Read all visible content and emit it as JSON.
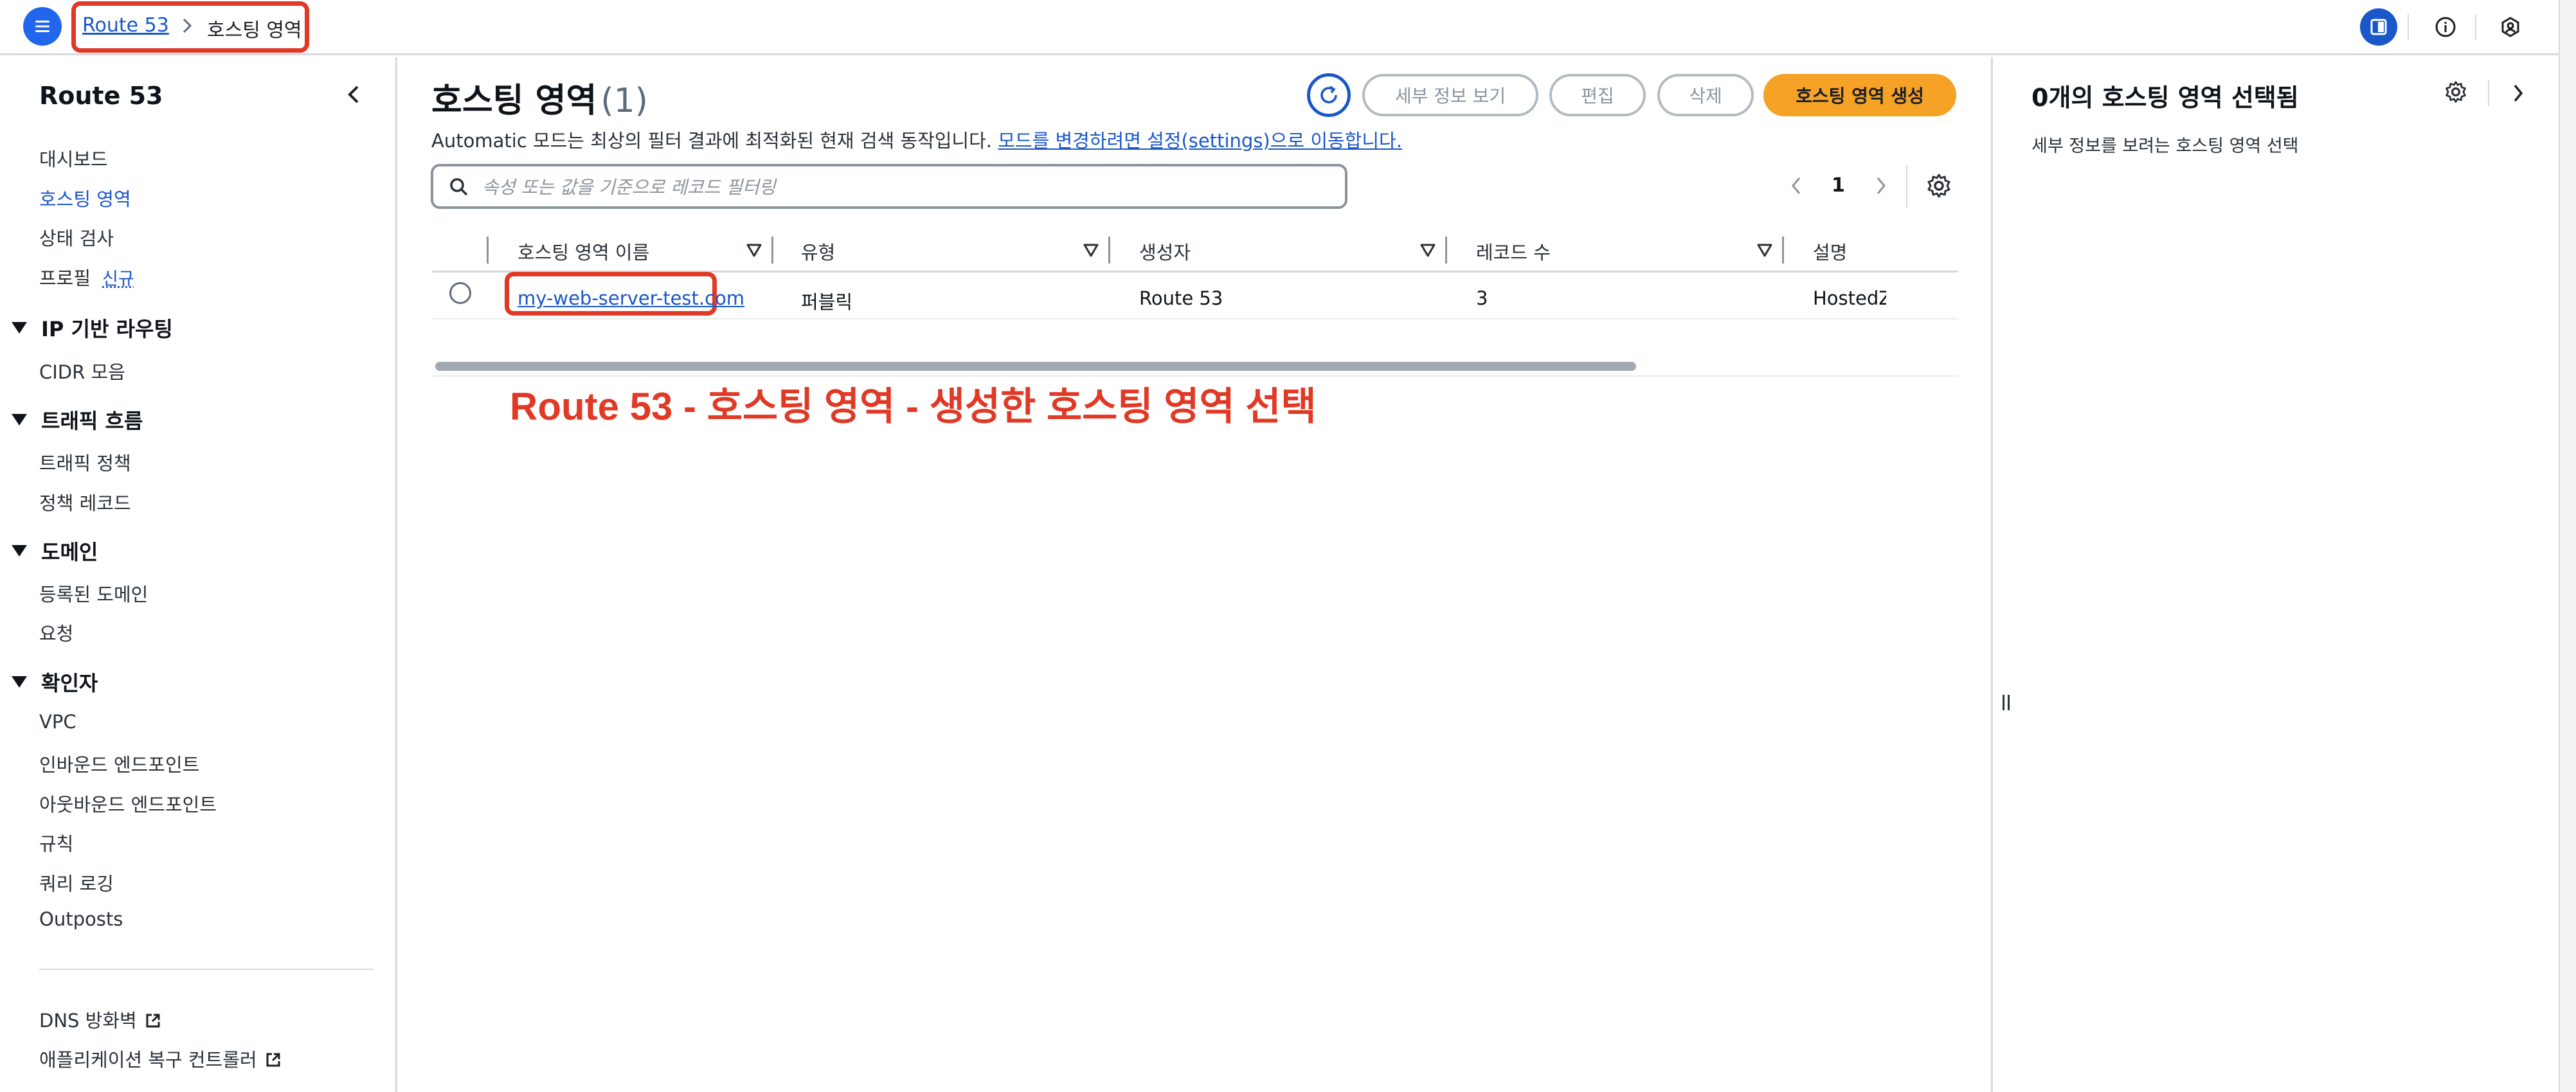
{
  "breadcrumb": {
    "root": "Route 53",
    "current": "호스팅 영역"
  },
  "nav": {
    "title": "Route 53",
    "items_top": [
      "대시보드",
      "호스팅 영역",
      "상태 검사",
      "프로필"
    ],
    "profile_badge": "신규",
    "sections": [
      {
        "title": "IP 기반 라우팅",
        "items": [
          "CIDR 모음"
        ]
      },
      {
        "title": "트래픽 흐름",
        "items": [
          "트래픽 정책",
          "정책 레코드"
        ]
      },
      {
        "title": "도메인",
        "items": [
          "등록된 도메인",
          "요청"
        ]
      },
      {
        "title": "확인자",
        "items": [
          "VPC",
          "인바운드 엔드포인트",
          "아웃바운드 엔드포인트",
          "규칙",
          "쿼리 로깅",
          "Outposts"
        ]
      }
    ],
    "bottom_items": [
      "DNS 방화벽",
      "애플리케이션 복구 컨트롤러"
    ]
  },
  "main": {
    "title": "호스팅 영역",
    "count": "(1)",
    "buttons": {
      "details": "세부 정보 보기",
      "edit": "편집",
      "delete": "삭제",
      "create": "호스팅 영역 생성"
    },
    "info_text": "Automatic 모드는 최상의 필터 결과에 최적화된 현재 검색 동작입니다.",
    "info_link": "모드를 변경하려면 설정(settings)으로 이동합니다.",
    "search_placeholder": "속성 또는 값을 기준으로 레코드 필터링",
    "page_number": "1",
    "table": {
      "headers": [
        "호스팅 영역 이름",
        "유형",
        "생성자",
        "레코드 수",
        "설명"
      ],
      "rows": [
        {
          "name": "my-web-server-test.com",
          "type": "퍼블릭",
          "created_by": "Route 53",
          "record_count": "3",
          "description": "HostedZ"
        }
      ]
    },
    "annotation": "Route 53 - 호스팅 영역 - 생성한 호스팅 영역 선택"
  },
  "right_panel": {
    "title": "0개의 호스팅 영역 선택됨",
    "description": "세부 정보를 보려는 호스팅 영역 선택"
  },
  "colors": {
    "accent": "#1a57c8",
    "primary_button": "#f5a226",
    "highlight": "#e03a26"
  }
}
